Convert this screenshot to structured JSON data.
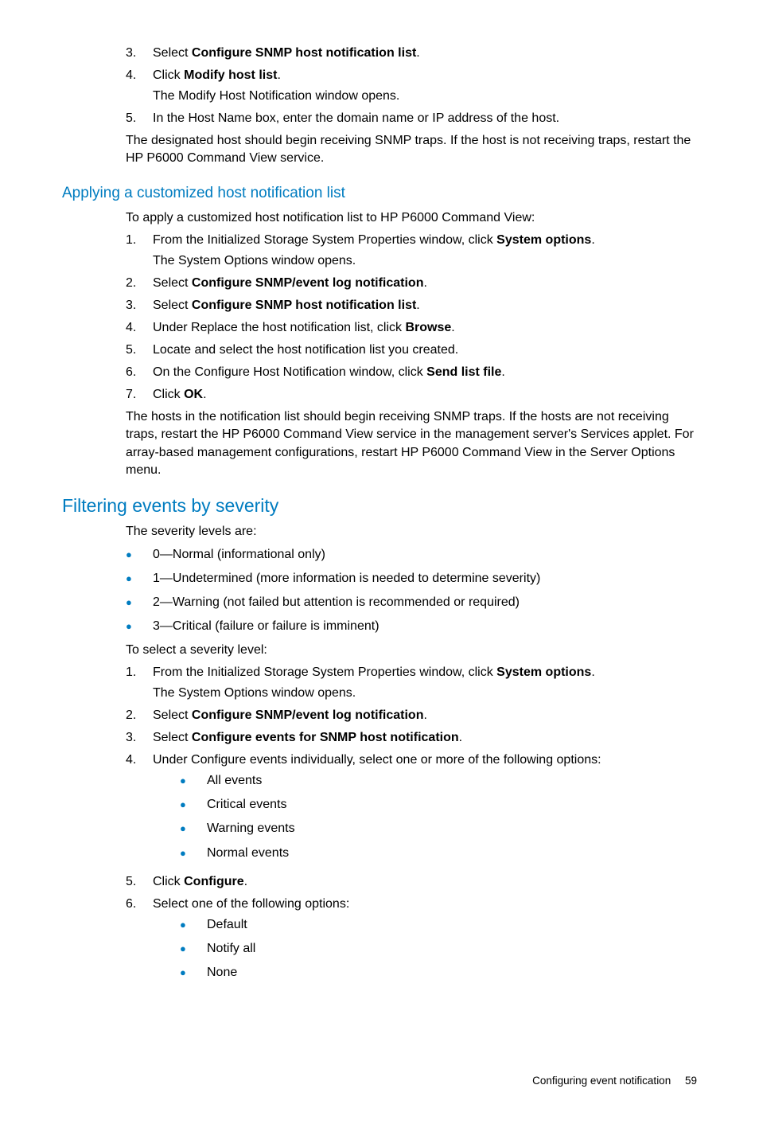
{
  "top": {
    "items": [
      {
        "num": "3.",
        "pre": "Select ",
        "bold": "Configure SNMP host notification list",
        "post": "."
      },
      {
        "num": "4.",
        "pre": "Click ",
        "bold": "Modify host list",
        "post": ".",
        "follow": "The Modify Host Notification window opens."
      },
      {
        "num": "5.",
        "pre": "In the Host Name box, enter the domain name or IP address of the host."
      }
    ],
    "para": "The designated host should begin receiving SNMP traps. If the host is not receiving traps, restart the HP P6000 Command View service."
  },
  "applying": {
    "heading": "Applying a customized host notification list",
    "intro": "To apply a customized host notification list to HP P6000 Command View:",
    "items": [
      {
        "num": "1.",
        "pre": "From the Initialized Storage System Properties window, click ",
        "bold": "System options",
        "post": ".",
        "follow": "The System Options window opens."
      },
      {
        "num": "2.",
        "pre": "Select ",
        "bold": "Configure SNMP/event log notification",
        "post": "."
      },
      {
        "num": "3.",
        "pre": "Select ",
        "bold": "Configure SNMP host notification list",
        "post": "."
      },
      {
        "num": "4.",
        "pre": "Under Replace the host notification list, click ",
        "bold": "Browse",
        "post": "."
      },
      {
        "num": "5.",
        "pre": "Locate and select the host notification list you created."
      },
      {
        "num": "6.",
        "pre": "On the Configure Host Notification window, click ",
        "bold": "Send list file",
        "post": "."
      },
      {
        "num": "7.",
        "pre": "Click ",
        "bold": "OK",
        "post": "."
      }
    ],
    "para": "The hosts in the notification list should begin receiving SNMP traps. If the hosts are not receiving traps, restart the HP P6000 Command View service in the management server's Services applet. For array-based management configurations, restart HP P6000 Command View in the Server Options menu."
  },
  "filtering": {
    "heading": "Filtering events by severity",
    "intro1": "The severity levels are:",
    "levels": [
      "0—Normal (informational only)",
      "1—Undetermined (more information is needed to determine severity)",
      "2—Warning (not failed but attention is recommended or required)",
      "3—Critical (failure or failure is imminent)"
    ],
    "intro2": "To select a severity level:",
    "items": [
      {
        "num": "1.",
        "pre": "From the Initialized Storage System Properties window, click ",
        "bold": "System options",
        "post": ".",
        "follow": "The System Options window opens."
      },
      {
        "num": "2.",
        "pre": "Select ",
        "bold": "Configure SNMP/event log notification",
        "post": "."
      },
      {
        "num": "3.",
        "pre": "Select ",
        "bold": "Configure events for SNMP host notification",
        "post": "."
      },
      {
        "num": "4.",
        "pre": "Under Configure events individually, select one or more of the following options:",
        "sub": [
          "All events",
          "Critical events",
          "Warning events",
          "Normal events"
        ]
      },
      {
        "num": "5.",
        "pre": "Click ",
        "bold": "Configure",
        "post": "."
      },
      {
        "num": "6.",
        "pre": "Select one of the following options:",
        "sub": [
          "Default",
          "Notify all",
          "None"
        ]
      }
    ]
  },
  "footer": {
    "label": "Configuring event notification",
    "page": "59"
  }
}
